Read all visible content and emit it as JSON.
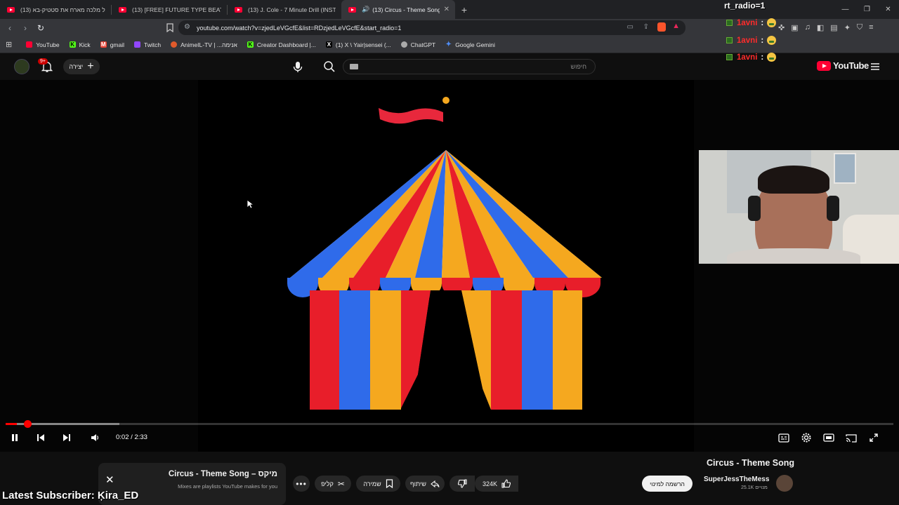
{
  "browser": {
    "tabs": [
      {
        "label": "(13) גל מלכה מארח את סטטיק-בא"
      },
      {
        "label": "(13) [FREE] FUTURE TYPE BEAT - \"HU"
      },
      {
        "label": "(13) J. Cole - 7 Minute Drill (INSTRUM"
      },
      {
        "label": "(13) Circus - Theme Song - Yo",
        "active": true
      }
    ],
    "url": "youtube.com/watch?v=zjedLeVGcfE&list=RDzjedLeVGcfE&start_radio=1",
    "bookmarks": [
      {
        "label": "YouTube",
        "color": "#ff0033"
      },
      {
        "label": "Kick",
        "color": "#53fc18"
      },
      {
        "label": "gmail",
        "color": "#ea4335"
      },
      {
        "label": "Twitch",
        "color": "#9146ff"
      },
      {
        "label": "AnimeIL-TV | ...אנימה",
        "color": "#e05a2b"
      },
      {
        "label": "Creator Dashboard |...",
        "color": "#53fc18"
      },
      {
        "label": "(1) X \\ Yair|sensei (...",
        "color": "#000000"
      },
      {
        "label": "ChatGPT",
        "color": "#aaaaaa"
      },
      {
        "label": "Google Gemini",
        "color": "#4f8df5"
      }
    ]
  },
  "youtube": {
    "create_label": "יצירה",
    "notification_count": "9+",
    "search_placeholder": "חיפוש",
    "logo_text": "YouTube"
  },
  "stream_chat": {
    "command": "rt_radio=1",
    "messages": [
      {
        "user": "1avni",
        "text": ":"
      },
      {
        "user": "1avni",
        "text": ":"
      },
      {
        "user": "1avni",
        "text": ":"
      },
      {
        "user": "1avni",
        "text": ":"
      },
      {
        "user": "1avni",
        "text": ":"
      }
    ]
  },
  "player": {
    "current_time": "0:02",
    "duration": "2:33",
    "time_display": "0:02 / 2:33",
    "progress": 0.013,
    "buffered": 0.128,
    "accent_color": "#ff0000"
  },
  "video": {
    "title": "Circus - Theme Song",
    "channel": "SuperJessTheMess",
    "subscribers": "25.1K מנויים",
    "subscribe_label": "הרשמה למינוי",
    "likes": "324K",
    "share_label": "שיתוף",
    "save_label": "שמירה",
    "clip_label": "קליפ"
  },
  "mix": {
    "title": "Circus - Theme Song – מיקס",
    "subtitle": "Mixes are playlists YouTube makes for you"
  },
  "overlay": {
    "latest_subscriber": "Latest Subscriber: Ķira_ED"
  }
}
